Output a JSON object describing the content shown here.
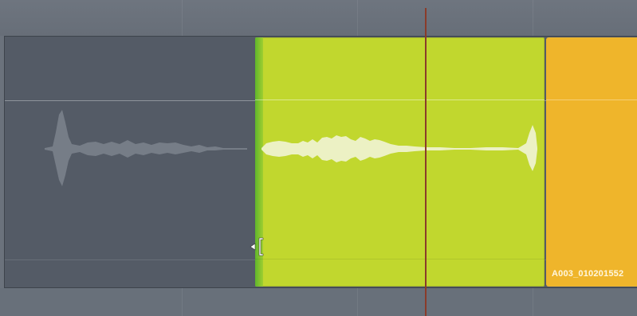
{
  "timeline": {
    "clips": [
      {
        "id": "previous-clip",
        "color": "#545b66",
        "selected": false
      },
      {
        "id": "selected-clip",
        "color": "#c1d72e",
        "selected": true
      },
      {
        "id": "next-clip",
        "color": "#efb52b",
        "name": "A003_010201552"
      }
    ],
    "cursor": "trim-edit-cursor"
  },
  "colors": {
    "background": "#6b727c",
    "track": "#545b66",
    "playhead": "#8a3b2a",
    "green_clip": "#c1d72e",
    "orange_clip": "#efb52b"
  }
}
